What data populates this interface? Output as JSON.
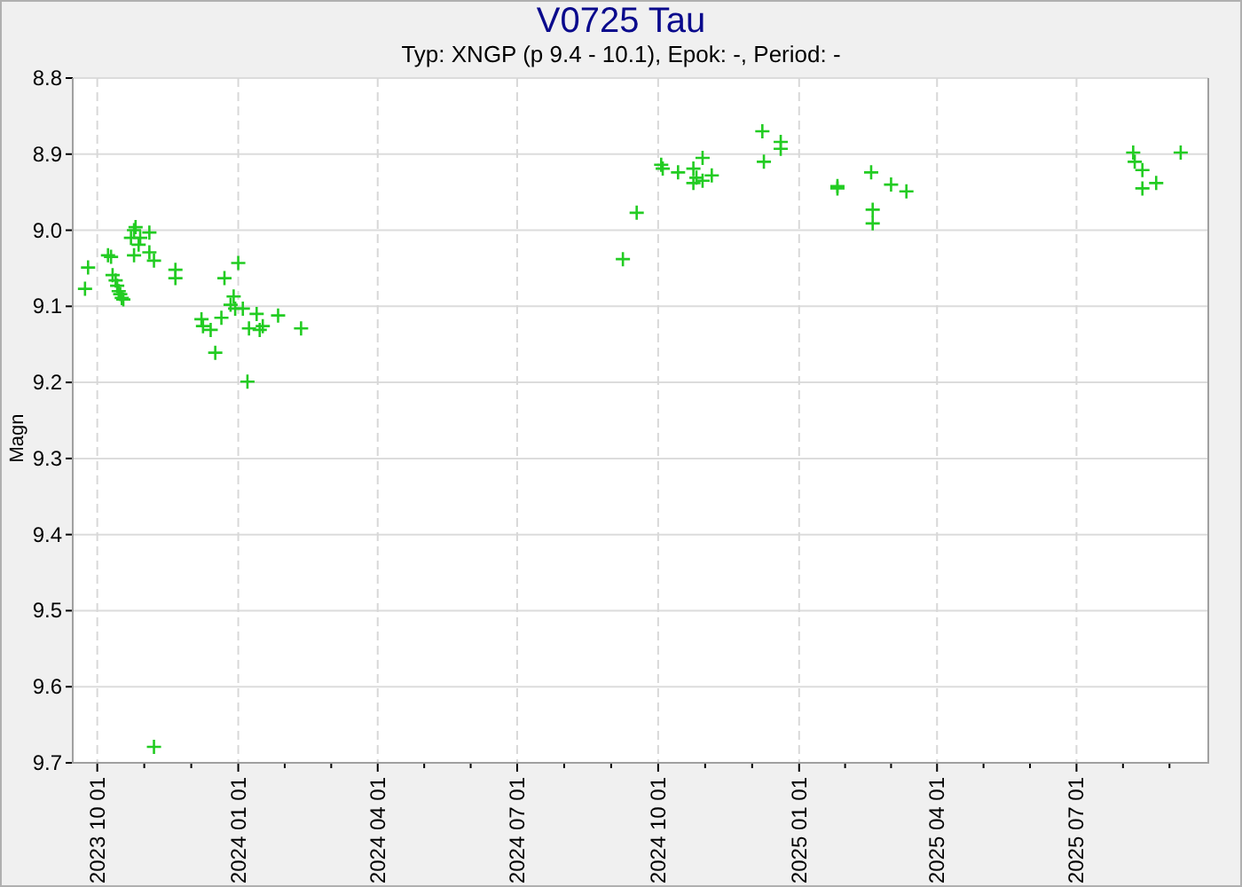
{
  "title": "V0725 Tau",
  "subtitle": "Typ: XNGP (p 9.4 - 10.1), Epok: -, Period: -",
  "chart_data": {
    "type": "scatter",
    "grid": true,
    "ylabel": "Magn",
    "xlim": [
      "2023-09-15",
      "2025-09-25"
    ],
    "ylim": [
      9.7,
      8.8
    ],
    "xticks": [
      {
        "value": "2023-10-01",
        "label": "2023 10 01"
      },
      {
        "value": "2024-01-01",
        "label": "2024 01 01"
      },
      {
        "value": "2024-04-01",
        "label": "2024 04 01"
      },
      {
        "value": "2024-07-01",
        "label": "2024 07 01"
      },
      {
        "value": "2024-10-01",
        "label": "2024 10 01"
      },
      {
        "value": "2025-01-01",
        "label": "2025 01 01"
      },
      {
        "value": "2025-04-01",
        "label": "2025 04 01"
      },
      {
        "value": "2025-07-01",
        "label": "2025 07 01"
      }
    ],
    "yticks": [
      {
        "value": 8.8,
        "label": "8.8"
      },
      {
        "value": 8.9,
        "label": "8.9"
      },
      {
        "value": 9.0,
        "label": "9.0"
      },
      {
        "value": 9.1,
        "label": "9.1"
      },
      {
        "value": 9.2,
        "label": "9.2"
      },
      {
        "value": 9.3,
        "label": "9.3"
      },
      {
        "value": 9.4,
        "label": "9.4"
      },
      {
        "value": 9.5,
        "label": "9.5"
      },
      {
        "value": 9.6,
        "label": "9.6"
      },
      {
        "value": 9.7,
        "label": "9.7"
      }
    ],
    "series": [
      {
        "color": "#22cc22",
        "x": [
          "2023-09-23",
          "2023-09-25",
          "2023-10-08",
          "2023-10-10",
          "2023-10-11",
          "2023-10-13",
          "2023-10-14",
          "2023-10-15",
          "2023-10-16",
          "2023-10-17",
          "2023-10-18",
          "2023-10-23",
          "2023-10-25",
          "2023-10-26",
          "2023-10-29",
          "2023-10-25",
          "2023-11-04",
          "2023-11-04",
          "2023-11-07",
          "2023-10-28",
          "2023-11-07",
          "2023-11-21",
          "2023-11-21",
          "2023-12-08",
          "2023-12-09",
          "2023-12-14",
          "2023-12-17",
          "2023-12-21",
          "2023-12-23",
          "2023-12-27",
          "2023-12-29",
          "2023-12-30",
          "2024-01-01",
          "2024-01-04",
          "2024-01-07",
          "2024-01-08",
          "2024-01-13",
          "2024-01-15",
          "2024-01-17",
          "2024-01-27",
          "2024-02-11",
          "2024-09-08",
          "2024-09-17",
          "2024-10-03",
          "2024-10-04",
          "2024-10-14",
          "2024-10-24",
          "2024-10-26",
          "2024-10-24",
          "2024-10-30",
          "2024-10-30",
          "2024-11-05",
          "2024-12-08",
          "2024-12-09",
          "2024-12-20",
          "2024-12-20",
          "2025-01-26",
          "2025-01-26",
          "2025-02-17",
          "2025-02-18",
          "2025-02-18",
          "2025-03-02",
          "2025-03-12",
          "2025-08-07",
          "2025-08-08",
          "2025-08-13",
          "2025-08-13",
          "2025-08-22",
          "2025-09-07"
        ],
        "values": [
          9.077,
          9.049,
          9.033,
          9.035,
          9.059,
          9.066,
          9.073,
          9.08,
          9.084,
          9.089,
          9.091,
          9.01,
          9.0,
          8.996,
          9.01,
          9.033,
          9.003,
          9.029,
          9.04,
          9.019,
          9.679,
          9.052,
          9.063,
          9.117,
          9.126,
          9.131,
          9.161,
          9.115,
          9.063,
          9.098,
          9.087,
          9.103,
          9.043,
          9.103,
          9.199,
          9.129,
          9.11,
          9.131,
          9.126,
          9.112,
          9.129,
          9.038,
          8.977,
          8.914,
          8.919,
          8.924,
          8.919,
          8.931,
          8.938,
          8.905,
          8.935,
          8.928,
          8.87,
          8.91,
          8.884,
          8.893,
          8.945,
          8.942,
          8.924,
          8.973,
          8.991,
          8.94,
          8.949,
          8.898,
          8.91,
          8.921,
          8.945,
          8.938,
          8.898
        ]
      }
    ]
  }
}
